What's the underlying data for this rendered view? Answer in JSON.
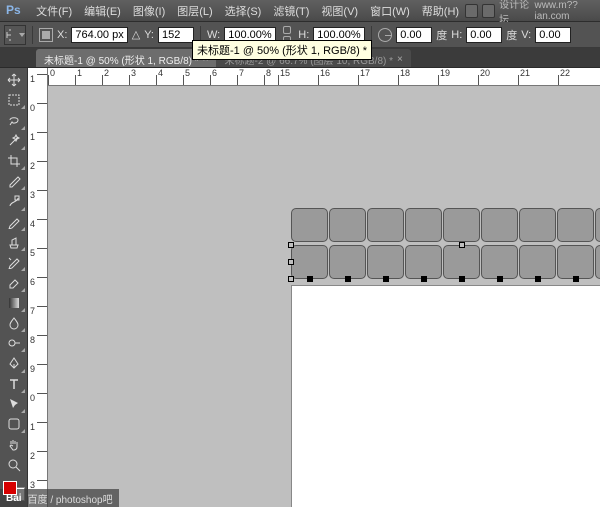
{
  "app": {
    "logo": "Ps"
  },
  "menus": {
    "file": "文件(F)",
    "edit": "编辑(E)",
    "image": "图像(I)",
    "layer": "图层(L)",
    "select": "选择(S)",
    "filter": "滤镜(T)",
    "view": "视图(V)",
    "window": "窗口(W)",
    "help": "帮助(H)"
  },
  "topright": {
    "forum": "设计论坛",
    "site": "www.m??ian.com"
  },
  "options": {
    "x_label": "X:",
    "x_value": "764.00 px",
    "y_label": "Y:",
    "y_value": "152",
    "w_label": "W:",
    "w_value": "100.00%",
    "h_label": "H:",
    "h_value": "100.00%",
    "angle_label": "",
    "angle_value": "0.00",
    "angle_unit": "度",
    "skew_h_label": "H:",
    "skew_h_value": "0.00",
    "skew_h_unit": "度",
    "skew_v_label": "V:",
    "skew_v_value": "0.00"
  },
  "tooltip": "未标题-1 @ 50% (形状 1, RGB/8) *",
  "doc_tabs": {
    "active": "未标题-1 @ 50% (形状 1, RGB/8) *",
    "inactive": "未标题-2 @ 66.7% (图层 10, RGB/8) *"
  },
  "ruler_h": [
    "0",
    "1",
    "2",
    "3",
    "4",
    "5",
    "6",
    "7",
    "8",
    "15",
    "16",
    "17",
    "18",
    "19",
    "20",
    "21",
    "22"
  ],
  "ruler_v": [
    "1",
    "0",
    "1",
    "2",
    "3",
    "4",
    "5",
    "6",
    "7",
    "8",
    "9",
    "0",
    "1",
    "2",
    "3"
  ],
  "watermark": {
    "logo": "Bai",
    "text": "百度 / photoshop吧"
  }
}
